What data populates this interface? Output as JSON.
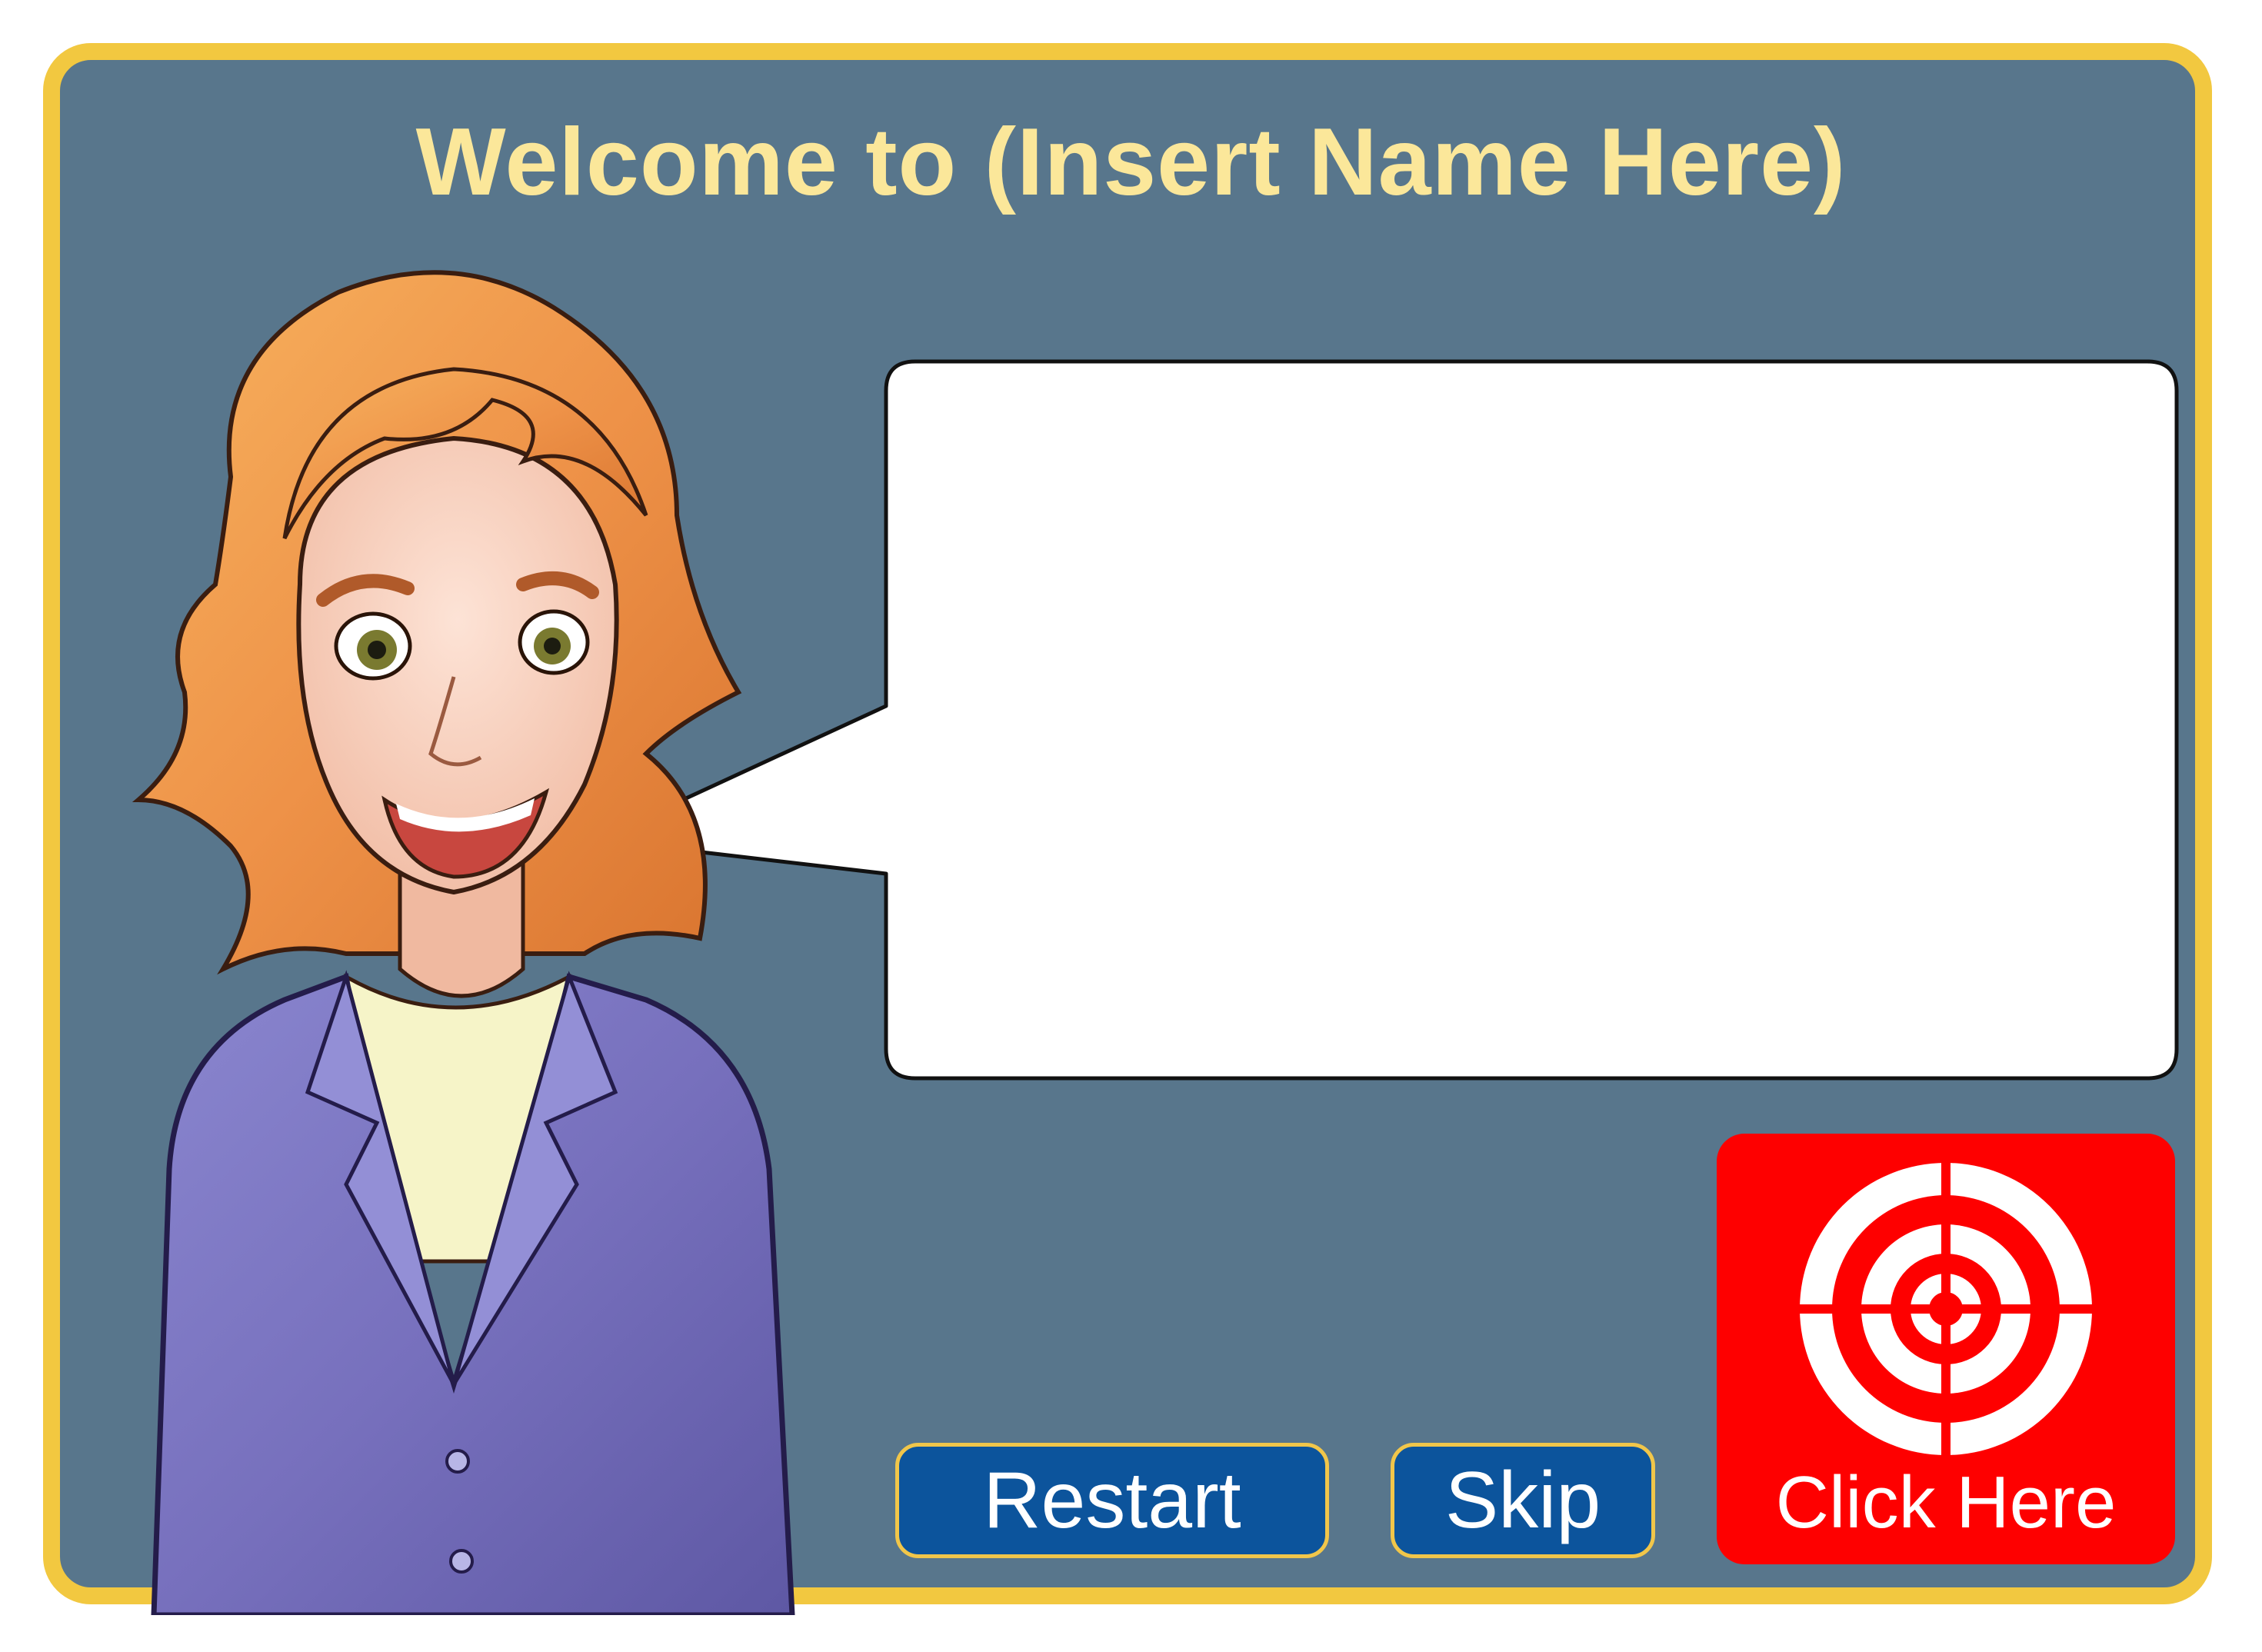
{
  "window": {
    "title": "Welcome to (Insert Name Here)"
  },
  "speech_bubble": {
    "text": ""
  },
  "buttons": {
    "restart_label": "Restart",
    "skip_label": "Skip",
    "click_here_label": "Click Here"
  },
  "icons": {
    "target": "target-icon",
    "presenter": "presenter-character"
  },
  "colors": {
    "background": "#58768c",
    "frame_border": "#f2c840",
    "title": "#fbe79a",
    "nav_button": "#0c549c",
    "nav_button_border": "#f1c64a",
    "target_button": "#fe0000"
  }
}
